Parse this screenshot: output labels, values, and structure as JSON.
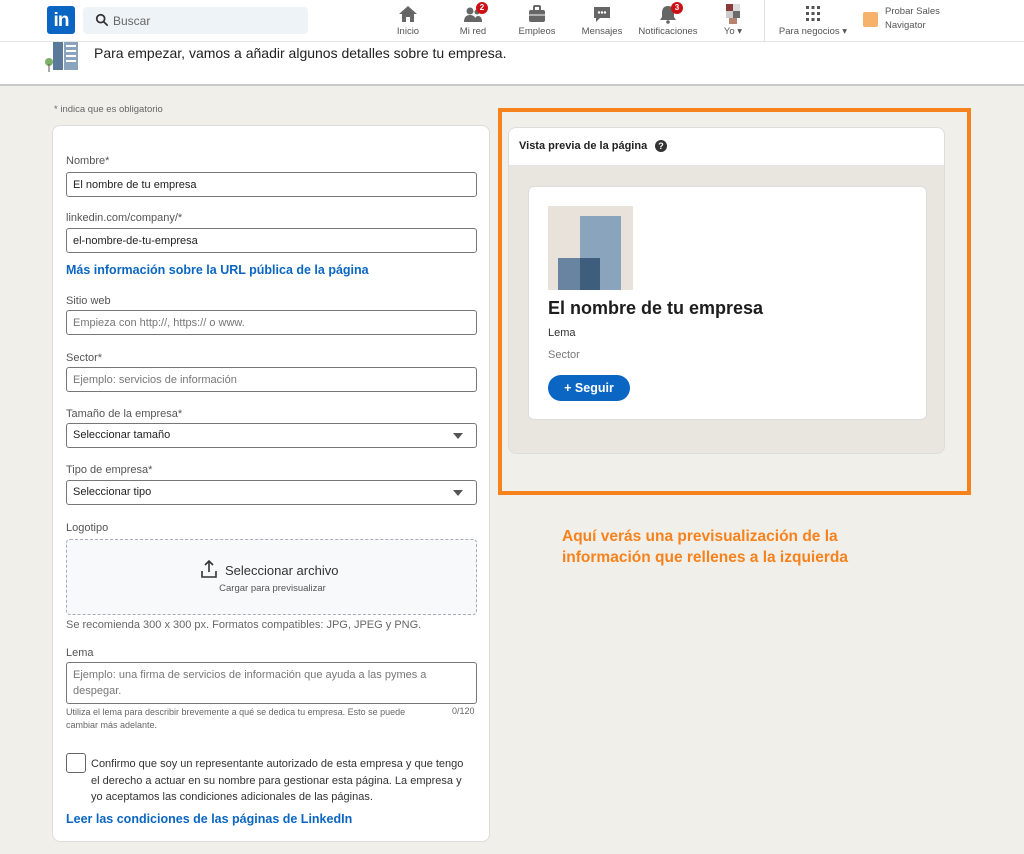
{
  "nav": {
    "logo_text": "in",
    "search_placeholder": "Buscar",
    "items": [
      {
        "label": "Inicio",
        "icon": "home-icon"
      },
      {
        "label": "Mi red",
        "icon": "network-icon",
        "badge": "2"
      },
      {
        "label": "Empleos",
        "icon": "briefcase-icon"
      },
      {
        "label": "Mensajes",
        "icon": "messaging-icon"
      },
      {
        "label": "Notificaciones",
        "icon": "bell-icon",
        "badge": "3"
      },
      {
        "label": "Yo",
        "icon": "avatar-icon"
      },
      {
        "label": "Para negocios",
        "icon": "grid-icon"
      }
    ],
    "sales_label": "Probar Sales Navigator"
  },
  "header": {
    "text": "Para empezar, vamos a añadir algunos detalles sobre tu empresa."
  },
  "form": {
    "required_note": "* indica que es obligatorio",
    "name_label": "Nombre*",
    "name_value": "El nombre de tu empresa",
    "url_label": "linkedin.com/company/*",
    "url_value": "el-nombre-de-tu-empresa",
    "url_help_link": "Más información sobre la URL pública de la página",
    "website_label": "Sitio web",
    "website_placeholder": "Empieza con http://, https:// o www.",
    "industry_label": "Sector*",
    "industry_placeholder": "Ejemplo: servicios de información",
    "size_label": "Tamaño de la empresa*",
    "size_value": "Seleccionar tamaño",
    "type_label": "Tipo de empresa*",
    "type_value": "Seleccionar tipo",
    "logo_label": "Logotipo",
    "upload_title": "Seleccionar archivo",
    "upload_sub": "Cargar para previsualizar",
    "logo_help": "Se recomienda 300 x 300 px. Formatos compatibles: JPG, JPEG y PNG.",
    "tagline_label": "Lema",
    "tagline_placeholder": "Ejemplo: una firma de servicios de información que ayuda a las pymes a despegar.",
    "tagline_help": "Utiliza el lema para describir brevemente a qué se dedica tu empresa. Esto se puede cambiar más adelante.",
    "tagline_counter": "0/120",
    "confirm_text": "Confirmo que soy un representante autorizado de esta empresa y que tengo el derecho a actuar en su nombre para gestionar esta página. La empresa y yo aceptamos las condiciones adicionales de las páginas.",
    "terms_link": "Leer las condiciones de las páginas de LinkedIn"
  },
  "preview": {
    "title": "Vista previa de la página",
    "help_glyph": "?",
    "company_name": "El nombre de tu empresa",
    "tagline": "Lema",
    "sector": "Sector",
    "follow_label": "+ Seguir"
  },
  "annotation": {
    "text": "Aquí verás una previsualización de la información que rellenes a la izquierda",
    "color": "#f7821b"
  },
  "colors": {
    "brand": "#0a66c2",
    "badge": "#cc1016",
    "background": "#f0efea"
  }
}
